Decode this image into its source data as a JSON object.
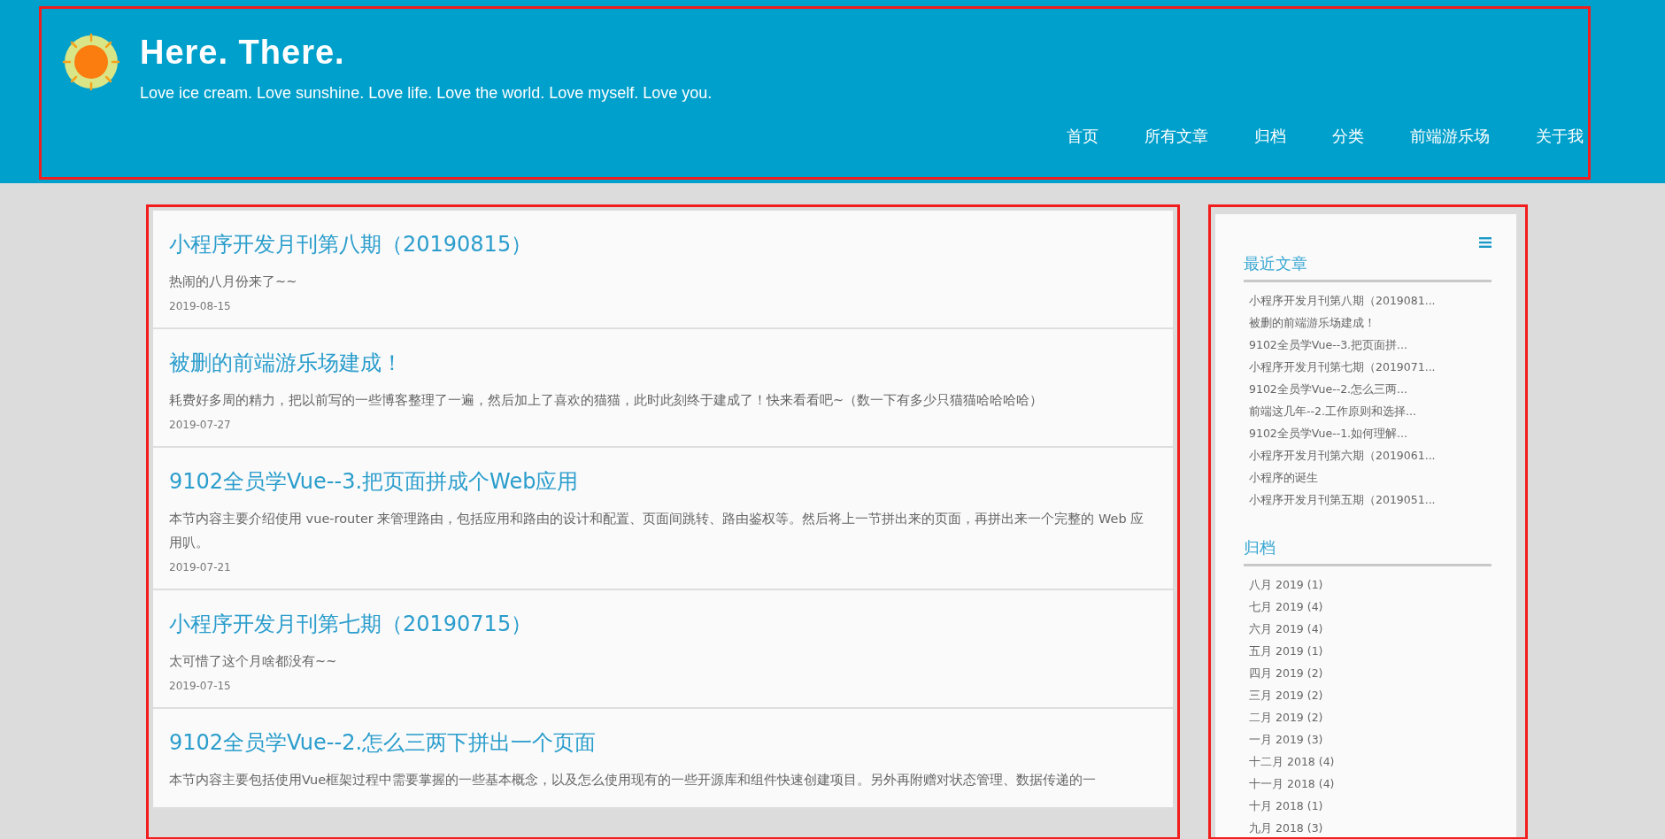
{
  "header": {
    "title": "Here. There.",
    "tagline": "Love ice cream. Love sunshine. Love life. Love the world. Love myself. Love you.",
    "nav": [
      "首页",
      "所有文章",
      "归档",
      "分类",
      "前端游乐场",
      "关于我"
    ]
  },
  "posts": [
    {
      "title": "小程序开发月刊第八期（20190815）",
      "summary": "热闹的八月份来了~~",
      "date": "2019-08-15"
    },
    {
      "title": "被删的前端游乐场建成！",
      "summary": "耗费好多周的精力，把以前写的一些博客整理了一遍，然后加上了喜欢的猫猫，此时此刻终于建成了！快来看看吧~（数一下有多少只猫猫哈哈哈哈）",
      "date": "2019-07-27"
    },
    {
      "title": "9102全员学Vue--3.把页面拼成个Web应用",
      "summary": "本节内容主要介绍使用 vue-router 来管理路由，包括应用和路由的设计和配置、页面间跳转、路由鉴权等。然后将上一节拼出来的页面，再拼出来一个完整的 Web 应用叭。",
      "date": "2019-07-21"
    },
    {
      "title": "小程序开发月刊第七期（20190715）",
      "summary": "太可惜了这个月啥都没有~~",
      "date": "2019-07-15"
    },
    {
      "title": "9102全员学Vue--2.怎么三两下拼出一个页面",
      "summary": "本节内容主要包括使用Vue框架过程中需要掌握的一些基本概念，以及怎么使用现有的一些开源库和组件快速创建项目。另外再附赠对状态管理、数据传递的一"
    }
  ],
  "sidebar": {
    "sections": [
      {
        "heading": "最近文章",
        "items": [
          "小程序开发月刊第八期（2019081...",
          "被删的前端游乐场建成！",
          "9102全员学Vue--3.把页面拼...",
          "小程序开发月刊第七期（2019071...",
          "9102全员学Vue--2.怎么三两...",
          "前端这几年--2.工作原则和选择...",
          "9102全员学Vue--1.如何理解...",
          "小程序开发月刊第六期（2019061...",
          "小程序的诞生",
          "小程序开发月刊第五期（2019051..."
        ]
      },
      {
        "heading": "归档",
        "items": [
          "八月 2019 (1)",
          "七月 2019 (4)",
          "六月 2019 (4)",
          "五月 2019 (1)",
          "四月 2019 (2)",
          "三月 2019 (2)",
          "二月 2019 (2)",
          "一月 2019 (3)",
          "十二月 2018 (4)",
          "十一月 2018 (4)",
          "十月 2018 (1)",
          "九月 2018 (3)"
        ]
      }
    ]
  }
}
